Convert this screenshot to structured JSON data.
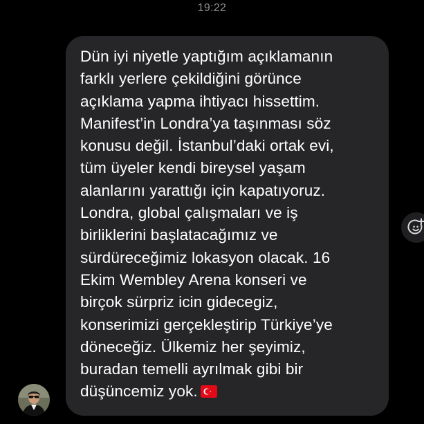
{
  "header": {
    "timestamp": "19:22"
  },
  "message": {
    "lines": [
      "Dün iyi niyetle yaptığım açıklamanın",
      "farklı yerlere çekildiğini görünce",
      "açıklama yapma ihtiyacı hissettim.",
      "Manifest’in Londra’ya taşınması söz",
      "konusu değil. İstanbul’daki ortak evi,",
      "tüm üyeler kendi bireysel yaşam",
      "alanlarını yarattığı için kapatıyoruz.",
      "Londra, global çalışmaları ve iş",
      "birliklerini başlatacağımız ve",
      "sürdüreceğimiz lokasyon olacak. 16",
      "Ekim Wembley Arena konseri ve",
      "birçok sürpriz icin gidecegiz,",
      "konserimizi gerçekleştirip Türkiye’ye",
      "döneceğiz. Ülkemiz her şeyimiz,",
      "buradan temelli ayrılmak gibi bir",
      "düşüncemiz yok."
    ],
    "emoji_icon": "turkey-flag-icon"
  },
  "reaction_button": {
    "icon": "add-reaction-icon"
  },
  "sender": {
    "avatar_icon": "sender-avatar"
  },
  "colors": {
    "background": "#000000",
    "bubble": "#262628",
    "text": "#ffffff",
    "timestamp": "#8e8e93",
    "flag_red": "#e30a17"
  }
}
